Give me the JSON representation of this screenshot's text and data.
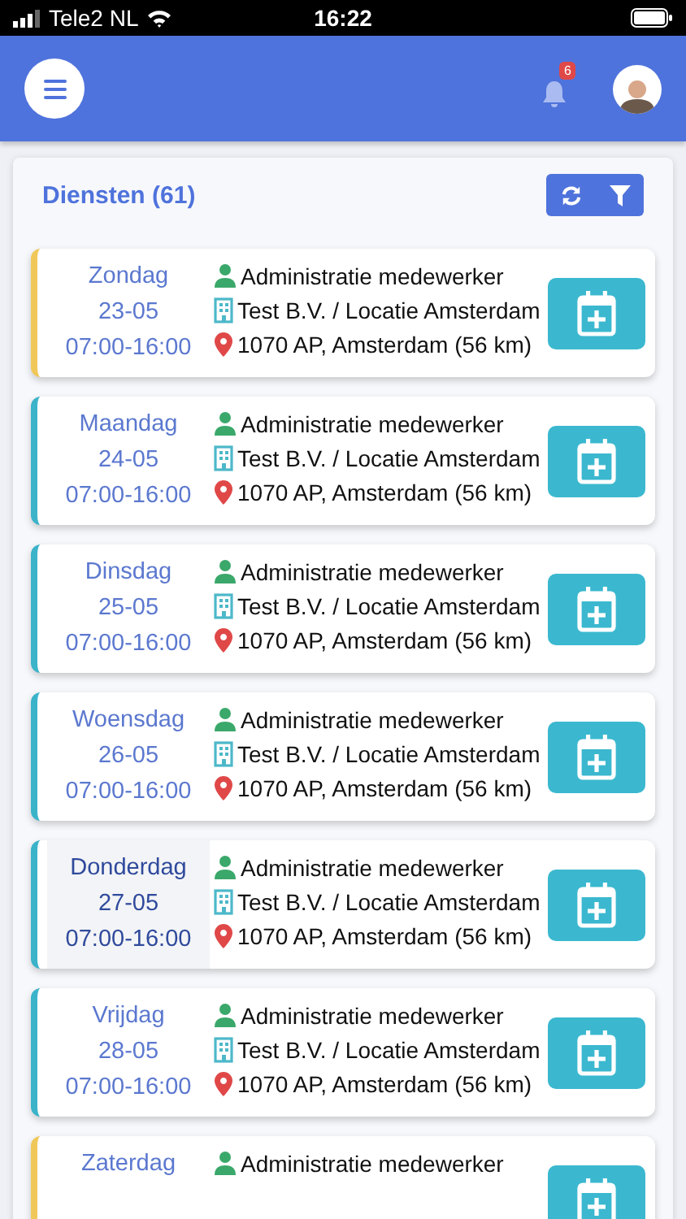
{
  "status_bar": {
    "carrier": "Tele2 NL",
    "time": "16:22"
  },
  "header": {
    "notification_count": "6"
  },
  "panel": {
    "title": "Diensten (61)"
  },
  "shifts": [
    {
      "day": "Zondag",
      "date": "23-05",
      "time": "07:00-16:00",
      "role": "Administratie medewerker",
      "company": "Test B.V. / Locatie Amsterdam",
      "address": "1070 AP, Amsterdam (56 km)",
      "color": "#f0c85a",
      "highlighted": false
    },
    {
      "day": "Maandag",
      "date": "24-05",
      "time": "07:00-16:00",
      "role": "Administratie medewerker",
      "company": "Test B.V. / Locatie Amsterdam",
      "address": "1070 AP, Amsterdam (56 km)",
      "color": "#3bb3c9",
      "highlighted": false
    },
    {
      "day": "Dinsdag",
      "date": "25-05",
      "time": "07:00-16:00",
      "role": "Administratie medewerker",
      "company": "Test B.V. / Locatie Amsterdam",
      "address": "1070 AP, Amsterdam (56 km)",
      "color": "#3bb3c9",
      "highlighted": false
    },
    {
      "day": "Woensdag",
      "date": "26-05",
      "time": "07:00-16:00",
      "role": "Administratie medewerker",
      "company": "Test B.V. / Locatie Amsterdam",
      "address": "1070 AP, Amsterdam (56 km)",
      "color": "#3bb3c9",
      "highlighted": false
    },
    {
      "day": "Donderdag",
      "date": "27-05",
      "time": "07:00-16:00",
      "role": "Administratie medewerker",
      "company": "Test B.V. / Locatie Amsterdam",
      "address": "1070 AP, Amsterdam (56 km)",
      "color": "#3bb3c9",
      "highlighted": true
    },
    {
      "day": "Vrijdag",
      "date": "28-05",
      "time": "07:00-16:00",
      "role": "Administratie medewerker",
      "company": "Test B.V. / Locatie Amsterdam",
      "address": "1070 AP, Amsterdam (56 km)",
      "color": "#3bb3c9",
      "highlighted": false
    },
    {
      "day": "Zaterdag",
      "role": "Administratie medewerker",
      "color": "#f0c85a",
      "highlighted": false
    }
  ]
}
